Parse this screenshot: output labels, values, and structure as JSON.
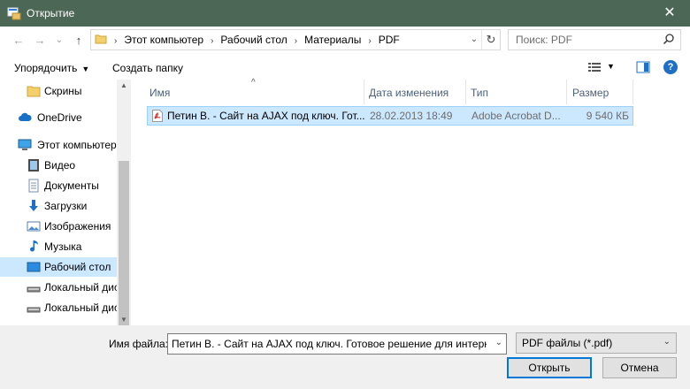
{
  "window": {
    "title": "Открытие",
    "close_label": "✕"
  },
  "navigation": {
    "back": "←",
    "forward": "→",
    "recent": "⌄",
    "up": "↑",
    "breadcrumbs": [
      "Этот компьютер",
      "Рабочий стол",
      "Материалы",
      "PDF"
    ],
    "separator": "›",
    "dropdown": "⌄",
    "refresh": "↻"
  },
  "search": {
    "placeholder": "Поиск: PDF"
  },
  "toolbar": {
    "organize_label": "Упорядочить",
    "organize_arrow": "▼",
    "new_folder_label": "Создать папку",
    "view_dd": "▼",
    "help_label": "?"
  },
  "sidebar": {
    "items": [
      {
        "label": "Скрины",
        "icon": "folder-icon"
      },
      {
        "label": "OneDrive",
        "icon": "cloud-icon"
      },
      {
        "label": "Этот компьютер",
        "icon": "computer-icon"
      },
      {
        "label": "Видео",
        "icon": "video-icon"
      },
      {
        "label": "Документы",
        "icon": "documents-icon"
      },
      {
        "label": "Загрузки",
        "icon": "download-icon"
      },
      {
        "label": "Изображения",
        "icon": "images-icon"
      },
      {
        "label": "Музыка",
        "icon": "music-icon"
      },
      {
        "label": "Рабочий стол",
        "icon": "desktop-icon",
        "selected": true
      },
      {
        "label": "Локальный дис",
        "icon": "drive-icon"
      },
      {
        "label": "Локальный дис",
        "icon": "drive-icon"
      }
    ],
    "scroll_up": "▲",
    "scroll_down": "▼"
  },
  "columns": {
    "name": "Имя",
    "date": "Дата изменения",
    "type": "Тип",
    "size": "Размер",
    "sort_indicator": "^"
  },
  "files": [
    {
      "name": "Петин В. - Сайт на AJAX под ключ. Гот...",
      "date": "28.02.2013 18:49",
      "type": "Adobe Acrobat D...",
      "size": "9 540 КБ"
    }
  ],
  "footer": {
    "filename_label": "Имя файла:",
    "filename_value": "Петин В. - Сайт на AJAX под ключ. Готовое решение для интернет-м",
    "filename_dd": "⌄",
    "filter_value": "PDF файлы (*.pdf)",
    "filter_dd": "⌄",
    "open_label": "Открыть",
    "cancel_label": "Отмена"
  },
  "colors": {
    "titlebar": "#4c6756",
    "selection": "#cce8ff",
    "accent": "#0078d7",
    "header_text": "#4c607a"
  }
}
